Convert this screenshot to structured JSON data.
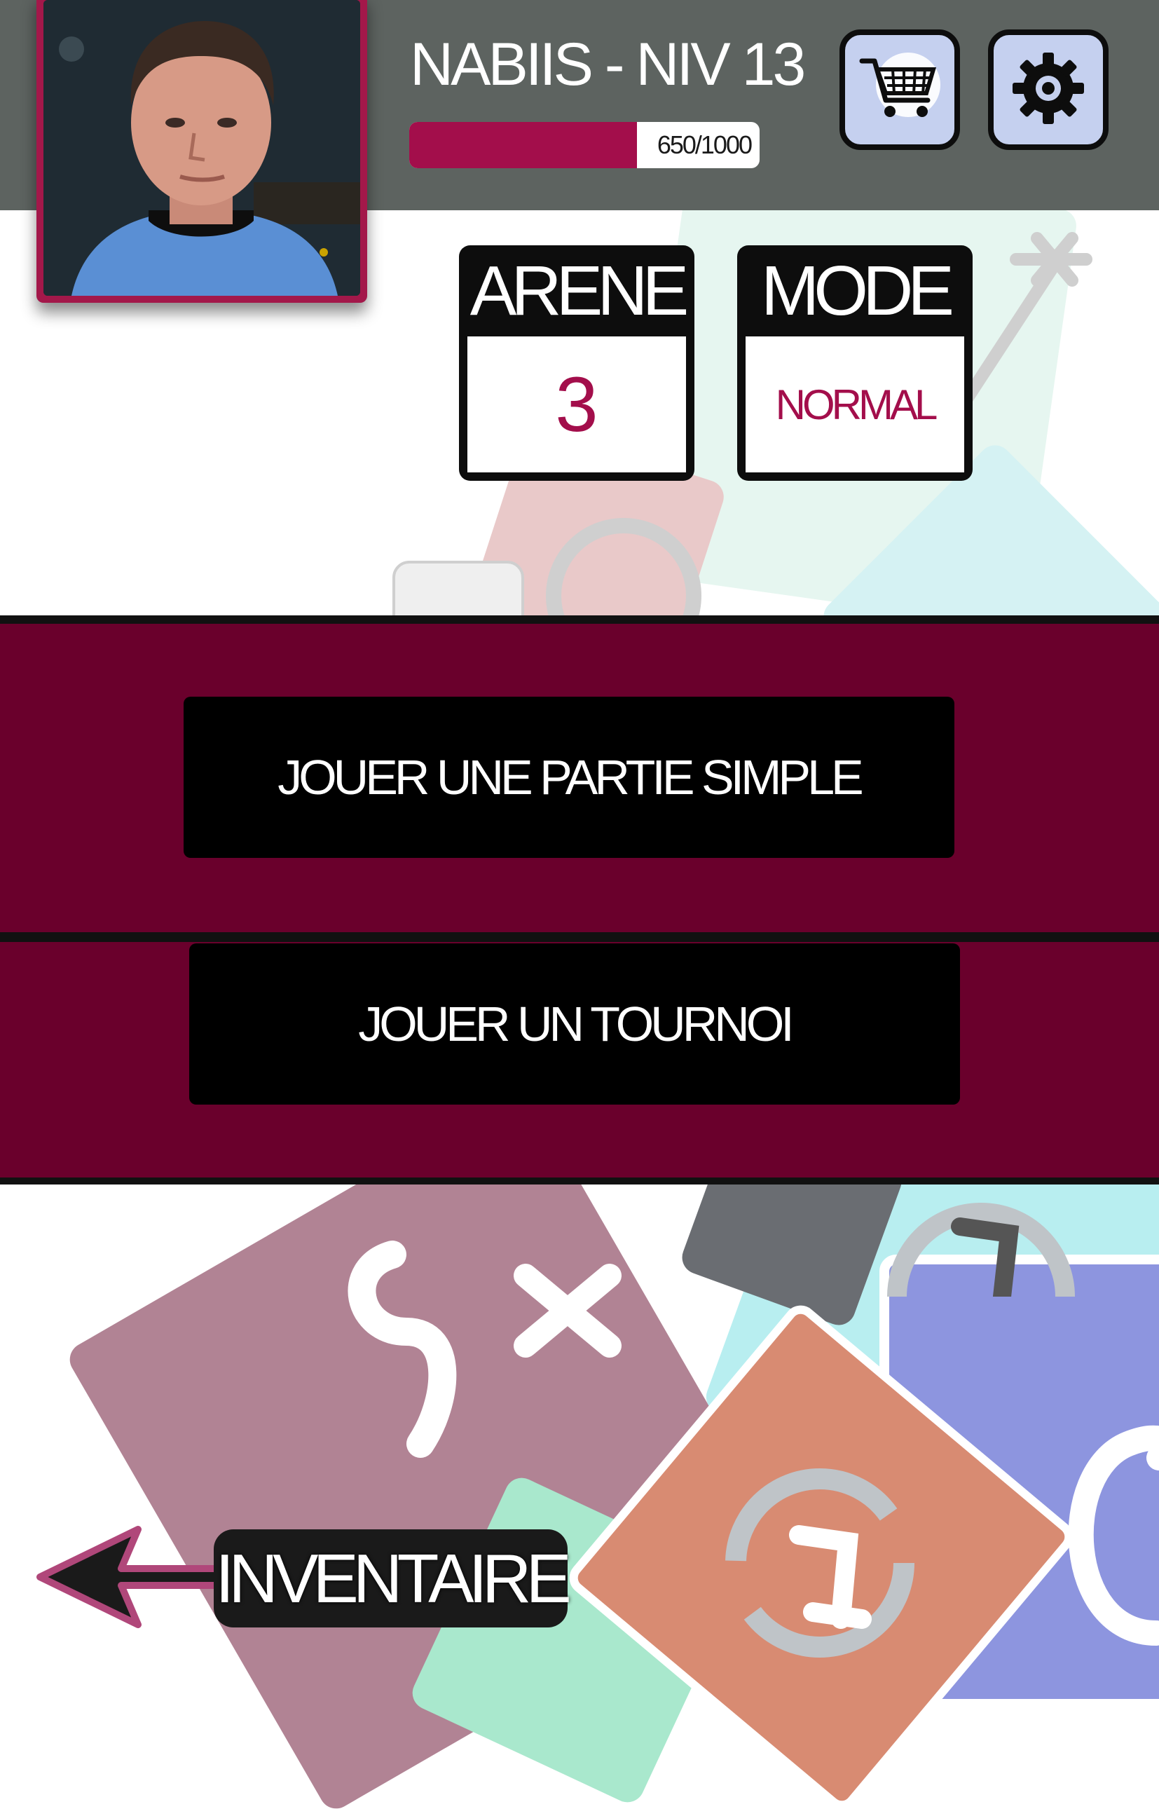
{
  "player": {
    "name_level": "NABIIS - NIV 13",
    "xp_text": "650/1000",
    "xp_progress": 0.65
  },
  "header_buttons": {
    "shop_icon": "shopping-cart-icon",
    "settings_icon": "gear-icon"
  },
  "arena": {
    "title": "ARENE",
    "value": "3"
  },
  "mode": {
    "title": "MODE",
    "value": "NORMAL"
  },
  "actions": {
    "simple_game": "JOUER UNE PARTIE SIMPLE",
    "tournament": "JOUER UN TOURNOI"
  },
  "inventory": {
    "label": "INVENTAIRE",
    "icon": "left-arrow-icon"
  },
  "colors": {
    "header_bg": "#5d6360",
    "accent": "#a30e4b",
    "band_bg": "#6a002c",
    "button_bg": "#000000",
    "icon_button_bg": "#c5d0ef"
  }
}
